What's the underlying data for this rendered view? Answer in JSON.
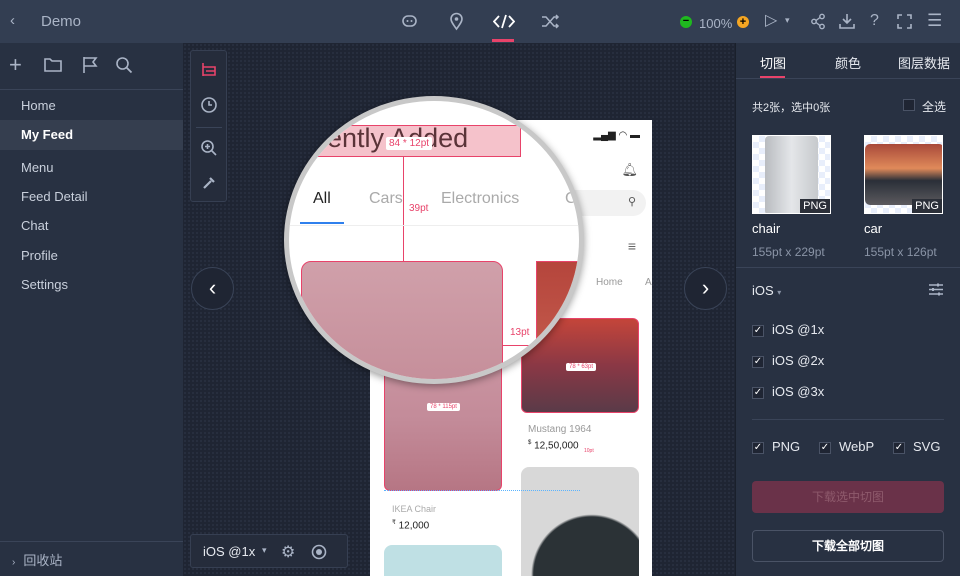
{
  "header": {
    "title": "Demo",
    "zoom": "100%",
    "tools": [
      "comment-icon",
      "location-pin-icon",
      "code-icon",
      "shuffle-icon"
    ],
    "active_tool": "code-icon"
  },
  "sidebar": {
    "items": [
      {
        "label": "Home"
      },
      {
        "label": "My Feed",
        "active": true
      },
      {
        "label": "Menu"
      },
      {
        "label": "Feed Detail"
      },
      {
        "label": "Chat"
      },
      {
        "label": "Profile"
      },
      {
        "label": "Settings"
      }
    ],
    "trash": "回收站"
  },
  "canvas": {
    "phone": {
      "heading": "Recently Added",
      "tabs": [
        "All",
        "Cars",
        "Electronics",
        "Cl"
      ],
      "side_tabs": [
        "Home",
        "Al"
      ],
      "products": [
        {
          "name": "IKEA Chair",
          "price": "12,000",
          "currency": "₹"
        },
        {
          "name": "Mustang 1964",
          "price": "12,50,000",
          "currency": "$"
        }
      ]
    },
    "measurements": {
      "heading_size": "84 * 12pt",
      "gap_vertical": "39pt",
      "gap_horizontal": "13pt",
      "chair_size": "78 * 115pt",
      "car_size": "78 * 63pt",
      "small_gap": "39pt",
      "bottom_gap": "10pt"
    },
    "bottom_bar": {
      "platform": "iOS @1x"
    }
  },
  "panel": {
    "tabs": [
      "切图",
      "颜色",
      "图层数据"
    ],
    "active_tab": "切图",
    "summary": "共2张，选中0张",
    "select_all": "全选",
    "assets": [
      {
        "name": "chair",
        "size": "155pt x 229pt",
        "format": "PNG"
      },
      {
        "name": "car",
        "size": "155pt x 126pt",
        "format": "PNG"
      }
    ],
    "platform": "iOS",
    "scales": [
      {
        "label": "iOS @1x",
        "checked": true
      },
      {
        "label": "iOS @2x",
        "checked": true
      },
      {
        "label": "iOS @3x",
        "checked": true
      }
    ],
    "formats": [
      {
        "label": "PNG",
        "checked": true
      },
      {
        "label": "WebP",
        "checked": true
      },
      {
        "label": "SVG",
        "checked": true
      }
    ],
    "download_selected": "下载选中切图",
    "download_all": "下载全部切图"
  },
  "colors": {
    "accent": "#e8436a",
    "zoom_out": "#1fb81f",
    "zoom_in": "#f5a623"
  }
}
